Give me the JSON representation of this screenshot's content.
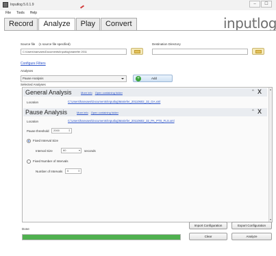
{
  "window": {
    "title": "Inputlog 5.0.1.9",
    "controls": [
      "–",
      "☐"
    ]
  },
  "menu": [
    "File",
    "Tools",
    "Help"
  ],
  "tabs": [
    {
      "label": "Record",
      "active": false
    },
    {
      "label": "Analyze",
      "active": true
    },
    {
      "label": "Play",
      "active": false
    },
    {
      "label": "Convert",
      "active": false
    }
  ],
  "logo": "inputlog",
  "source": {
    "label": "Source file",
    "hint": "(1 source file specified)",
    "value": "C:\\Users\\hanvaes\\Documents\\Inputlog\\mariefer 2011",
    "dest_label": "Destination Directory",
    "dest_value": ""
  },
  "configure_filters": "Configure Filters",
  "analyses": {
    "label": "Analyses",
    "selected": "Pause Analysis",
    "add_label": "Add",
    "add_icon": "plus-icon"
  },
  "selected_analyses_label": "Selected Analyses",
  "general_analysis": {
    "title": "General Analysis",
    "more_info": "More info",
    "open_folder": "Open containing folder",
    "location_label": "Location",
    "location_value": "C:\\Users\\hanvaes\\Documents\\Inputlog\\Mariefer_20110602_32_GA.xml",
    "collapse": "^",
    "close": "X"
  },
  "pause_analysis": {
    "title": "Pause Analysis",
    "more_info": "More info",
    "open_folder": "Open containing folder",
    "location_label": "Location",
    "location_value": "C:\\Users\\hanvaes\\Documents\\Inputlog\\Mariefer_20110602_32_PA_PTS_FLS.xml",
    "collapse": "^",
    "close": "X",
    "threshold_label": "Pause threshold",
    "threshold_value": "2000",
    "fixed_interval_label": "Fixed Interval Size",
    "interval_size_label": "Interval Size",
    "interval_size_value": "60",
    "interval_unit": "seconds",
    "fixed_number_label": "Fixed Number of Intervals",
    "number_label": "Number of Intervals",
    "number_value": "5"
  },
  "bottom": {
    "status": "Done",
    "progress": 1.0,
    "import_config": "Import Configuration",
    "export_config": "Export Configuration",
    "clear": "Clear",
    "analyze": "Analyze"
  },
  "colors": {
    "link": "#2a52c9",
    "progress": "#4fb04f",
    "add_icon": "#3aa43a",
    "accent_deco": "#d23b3b"
  }
}
